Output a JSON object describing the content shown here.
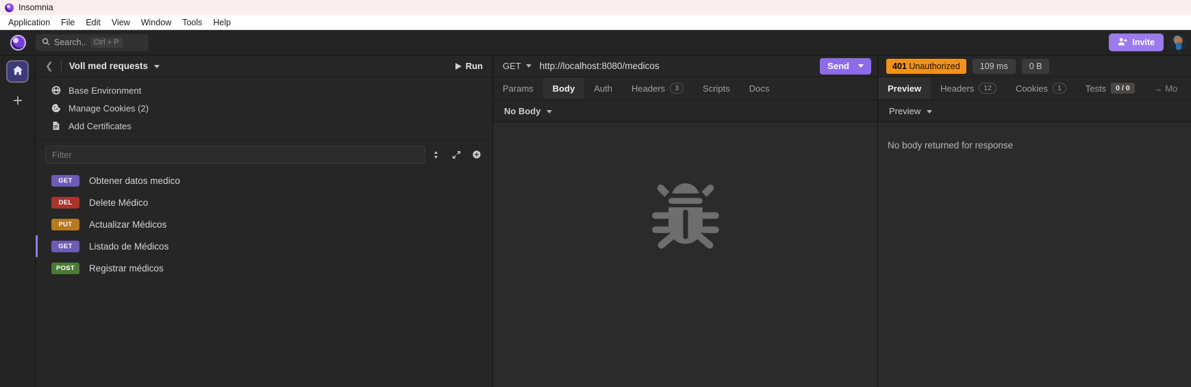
{
  "window": {
    "title": "Insomnia",
    "logo_icon": "insomnia-logo-icon"
  },
  "menubar": {
    "items": [
      "Application",
      "File",
      "Edit",
      "View",
      "Window",
      "Tools",
      "Help"
    ]
  },
  "topbar": {
    "search": {
      "placeholder": "Search..",
      "shortcut": "Ctrl + P",
      "icon": "search-icon"
    },
    "invite_label": "Invite",
    "invite_icon": "person-add-icon",
    "avatar": "user-avatar"
  },
  "rail": {
    "home_icon": "home-icon",
    "add_icon": "plus-icon"
  },
  "sidebar": {
    "back_icon": "chevron-left-icon",
    "workspace_title": "Voll med requests",
    "run_label": "Run",
    "run_icon": "play-icon",
    "env_items": [
      {
        "label": "Base Environment",
        "icon": "globe-icon"
      },
      {
        "label": "Manage Cookies (2)",
        "icon": "cookie-icon"
      },
      {
        "label": "Add Certificates",
        "icon": "certificate-icon"
      }
    ],
    "filter_placeholder": "Filter",
    "filter_icons": [
      "sort-icon",
      "expand-icon",
      "plus-circle-icon"
    ],
    "requests": [
      {
        "method": "GET",
        "name": "Obtener datos medico",
        "color": "#6d5bb5",
        "active": false
      },
      {
        "method": "DEL",
        "name": "Delete Médico",
        "color": "#a8352c",
        "active": false
      },
      {
        "method": "PUT",
        "name": "Actualizar Médicos",
        "color": "#b5791f",
        "active": false
      },
      {
        "method": "GET",
        "name": "Listado de Médicos",
        "color": "#6d5bb5",
        "active": true
      },
      {
        "method": "POST",
        "name": "Registrar médicos",
        "color": "#4b7a34",
        "active": false
      }
    ]
  },
  "request": {
    "method": "GET",
    "url": "http://localhost:8080/medicos",
    "send_label": "Send",
    "tabs": [
      {
        "label": "Params",
        "badge": "",
        "active": false
      },
      {
        "label": "Body",
        "badge": "",
        "active": true
      },
      {
        "label": "Auth",
        "badge": "",
        "active": false
      },
      {
        "label": "Headers",
        "badge": "3",
        "active": false
      },
      {
        "label": "Scripts",
        "badge": "",
        "active": false
      },
      {
        "label": "Docs",
        "badge": "",
        "active": false
      }
    ],
    "body_type": "No Body",
    "empty_icon": "bug-icon"
  },
  "response": {
    "status_code": "401",
    "status_text": "Unauthorized",
    "status_color": "#f0921d",
    "time": "109 ms",
    "size": "0 B",
    "tabs": [
      {
        "label": "Preview",
        "badge": "",
        "active": true,
        "solid": false
      },
      {
        "label": "Headers",
        "badge": "12",
        "active": false,
        "solid": false
      },
      {
        "label": "Cookies",
        "badge": "1",
        "active": false,
        "solid": false
      },
      {
        "label": "Tests",
        "badge": "0 / 0",
        "active": false,
        "solid": true
      }
    ],
    "more_label": "→ Mo",
    "view_mode": "Preview",
    "empty_message": "No body returned for response"
  }
}
